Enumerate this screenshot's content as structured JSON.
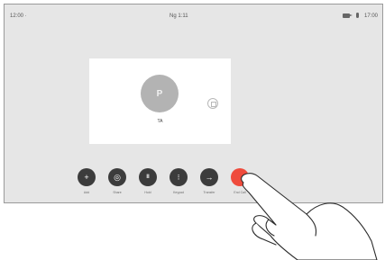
{
  "status_bar": {
    "left_text": "12:00 ·",
    "center_text": "Ng 1:11",
    "time": "17:00",
    "icons": [
      "camera-icon",
      "microphone-icon"
    ]
  },
  "self_view": {
    "avatar_initials": "P",
    "participant_name": "TA"
  },
  "controls": [
    {
      "name": "add",
      "icon": "plus-icon",
      "glyph": "+",
      "label": "Add",
      "color": "#3c3c3c"
    },
    {
      "name": "share",
      "icon": "share-icon",
      "glyph": "◎",
      "label": "Share",
      "color": "#3c3c3c"
    },
    {
      "name": "hold",
      "icon": "pause-icon",
      "glyph": "II",
      "label": "Hold",
      "color": "#3c3c3c"
    },
    {
      "name": "keypad",
      "icon": "keypad-icon",
      "glyph": "⁝",
      "label": "Keypad",
      "color": "#3c3c3c"
    },
    {
      "name": "transfer",
      "icon": "transfer-icon",
      "glyph": "→",
      "label": "Transfer",
      "color": "#3c3c3c"
    },
    {
      "name": "end-call",
      "icon": "end-call-icon",
      "glyph": "",
      "label": "End Call",
      "color": "#ef4b3c"
    }
  ],
  "colors": {
    "frame": "#e6e6e6",
    "button_dark": "#3c3c3c",
    "end_call_red": "#ef4b3c",
    "self_view_bg": "#ffffff"
  }
}
